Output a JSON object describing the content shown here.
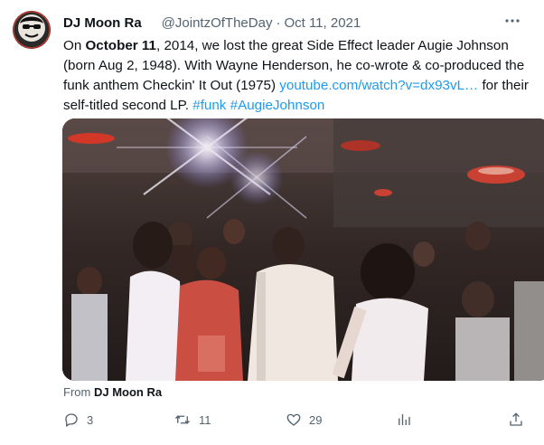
{
  "tweet": {
    "author_name": "DJ Moon Ra",
    "author_handle": "@JointzOfTheDay",
    "separator": "·",
    "date": "Oct 11, 2021",
    "text": {
      "p1": "On ",
      "b1": "October 11",
      "p2": ", 2014, we lost the great Side Effect leader Augie Johnson (born Aug 2, 1948). With Wayne Henderson, he co-wrote & co-produced the funk anthem Checkin' It Out (1975) ",
      "link": "youtube.com/watch?v=dx93vL…",
      "p3": " for their self-titled second LP. ",
      "tag1": "#funk",
      "tag2": "#AugieJohnson"
    },
    "media_from_label": "From",
    "media_from_name": "DJ Moon Ra"
  },
  "actions": {
    "reply_count": "3",
    "retweet_count": "11",
    "like_count": "29"
  },
  "icons": {
    "more": "more-horizontal-icon",
    "reply": "reply-icon",
    "retweet": "retweet-icon",
    "like": "heart-icon",
    "views": "analytics-icon",
    "share": "share-icon"
  },
  "colors": {
    "link": "#1d9bf0",
    "secondary_text": "#536471",
    "primary_text": "#0f1419"
  }
}
